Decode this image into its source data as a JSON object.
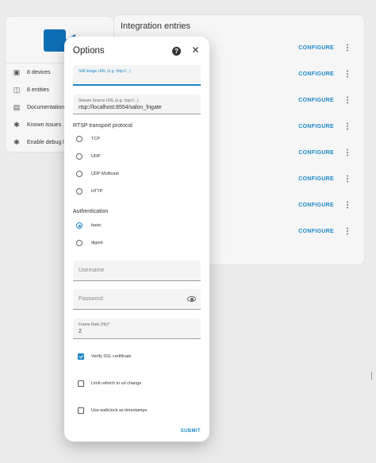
{
  "info_card": {
    "items": [
      {
        "icon": "devices-icon",
        "label": "8 devices"
      },
      {
        "icon": "entities-icon",
        "label": "8 entities"
      },
      {
        "icon": "book-icon",
        "label": "Documentation"
      },
      {
        "icon": "bug-icon",
        "label": "Known issues"
      },
      {
        "icon": "bug-icon",
        "label": "Enable debug lo"
      }
    ]
  },
  "entries": {
    "title": "Integration entries",
    "configure_label": "CONFIGURE",
    "count": 8
  },
  "dialog": {
    "title": "Options",
    "still_image_label": "Still Image URL (e.g. http://...)",
    "stream_source_label": "Stream Source URL (e.g. rtsp://...)",
    "stream_source_value": "rtsp://localhost:8554/salon_frigate",
    "rtsp_label": "RTSP transport protocol",
    "rtsp_options": [
      "TCP",
      "UDP",
      "UDP Multicast",
      "HTTP"
    ],
    "auth_label": "Authentication",
    "auth_options": [
      "basic",
      "digest"
    ],
    "auth_selected": "basic",
    "username_placeholder": "Username",
    "password_placeholder": "Password",
    "frame_rate_label": "Frame Rate (Hz)*",
    "frame_rate_value": "2",
    "checks": [
      {
        "label": "Verify SSL certificate",
        "checked": true
      },
      {
        "label": "Limit refetch to url change",
        "checked": false
      },
      {
        "label": "Use wallclock as timestamps",
        "checked": false
      }
    ],
    "submit_label": "SUBMIT"
  },
  "colors": {
    "accent": "#1e88c9",
    "brand": "#0f6fb6"
  }
}
